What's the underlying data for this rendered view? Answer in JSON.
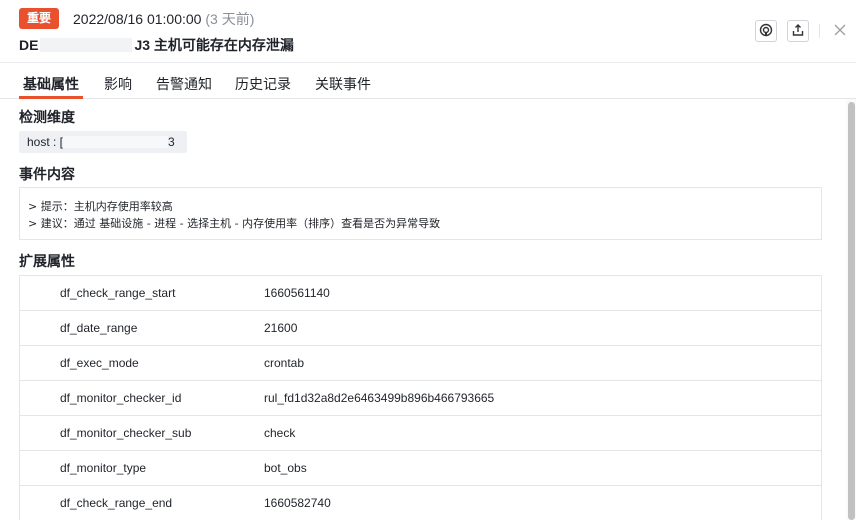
{
  "header": {
    "badge": "重要",
    "timestamp": "2022/08/16 01:00:00",
    "relative": "(3 天前)",
    "title_prefix": "DE",
    "title_suffix": "J3 主机可能存在内存泄漏",
    "icons": [
      "monitor-icon",
      "export-icon",
      "close-icon"
    ]
  },
  "tabs": [
    {
      "label": "基础属性",
      "active": true
    },
    {
      "label": "影响",
      "active": false
    },
    {
      "label": "告警通知",
      "active": false
    },
    {
      "label": "历史记录",
      "active": false
    },
    {
      "label": "关联事件",
      "active": false
    }
  ],
  "dimension": {
    "title": "检测维度",
    "host_prefix": "host : [",
    "host_suffix": "3"
  },
  "event_content": {
    "title": "事件内容",
    "lines": [
      "> 提示：主机内存使用率较高",
      "> 建议：通过 基础设施 - 进程 - 选择主机 - 内存使用率（排序）查看是否为异常导致"
    ]
  },
  "extended": {
    "title": "扩展属性",
    "rows": [
      {
        "key": "df_check_range_start",
        "value": "1660561140"
      },
      {
        "key": "df_date_range",
        "value": "21600"
      },
      {
        "key": "df_exec_mode",
        "value": "crontab"
      },
      {
        "key": "df_monitor_checker_id",
        "value": "rul_fd1d32a8d2e6463499b896b466793665"
      },
      {
        "key": "df_monitor_checker_sub",
        "value": "check"
      },
      {
        "key": "df_monitor_type",
        "value": "bot_obs"
      },
      {
        "key": "df_check_range_end",
        "value": "1660582740"
      }
    ]
  },
  "colors": {
    "accent": "#e9512e",
    "text": "#1f2329",
    "muted": "#8a8f99",
    "border": "#e3e5e8"
  }
}
